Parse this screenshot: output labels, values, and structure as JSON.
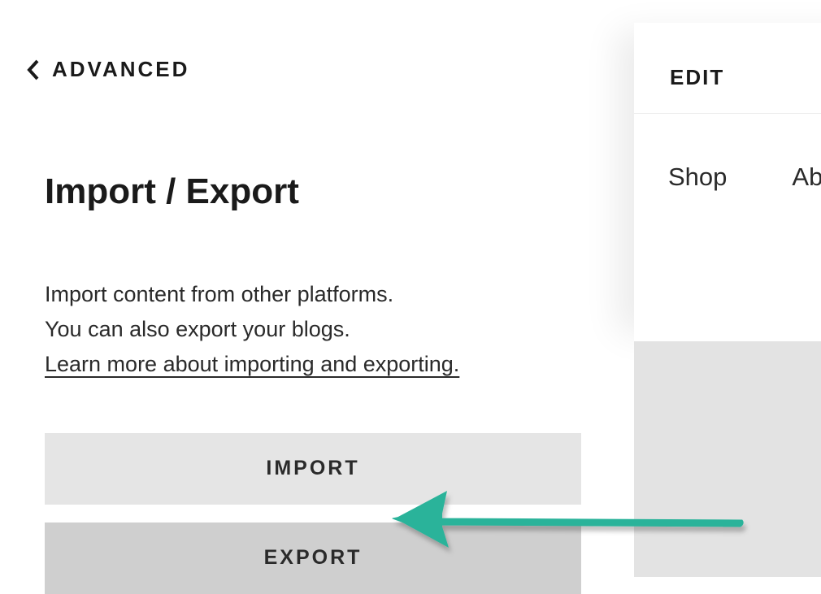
{
  "nav": {
    "back_label": "ADVANCED"
  },
  "page": {
    "title": "Import / Export",
    "description_line1": "Import content from other platforms.",
    "description_line2": "You can also export your blogs.",
    "learn_more_link": "Learn more about importing and exporting."
  },
  "buttons": {
    "import_label": "IMPORT",
    "export_label": "EXPORT"
  },
  "preview": {
    "edit_label": "EDIT",
    "nav_items": [
      "Shop",
      "About"
    ]
  },
  "annotation": {
    "arrow_color": "#2bb39a"
  }
}
